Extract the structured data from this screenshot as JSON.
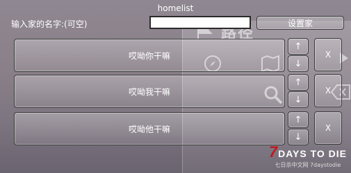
{
  "window": {
    "title": "homelist"
  },
  "name_field": {
    "label": "输入家的名字:(可空)",
    "value": ""
  },
  "set_home_button": "设置家",
  "homes": [
    {
      "name": "哎呦你干嘛",
      "up": "↑",
      "down": "↓",
      "remove": "X"
    },
    {
      "name": "哎呦我干嘛",
      "up": "↑",
      "down": "↓",
      "remove": "X"
    },
    {
      "name": "哎呦他干嘛",
      "up": "↑",
      "down": "↓",
      "remove": "X"
    }
  ],
  "background": {
    "title": "路径"
  },
  "brand": {
    "main": "DAYS TO DIE",
    "number": "7",
    "sub": "七日杀中文网 7daystodie"
  }
}
